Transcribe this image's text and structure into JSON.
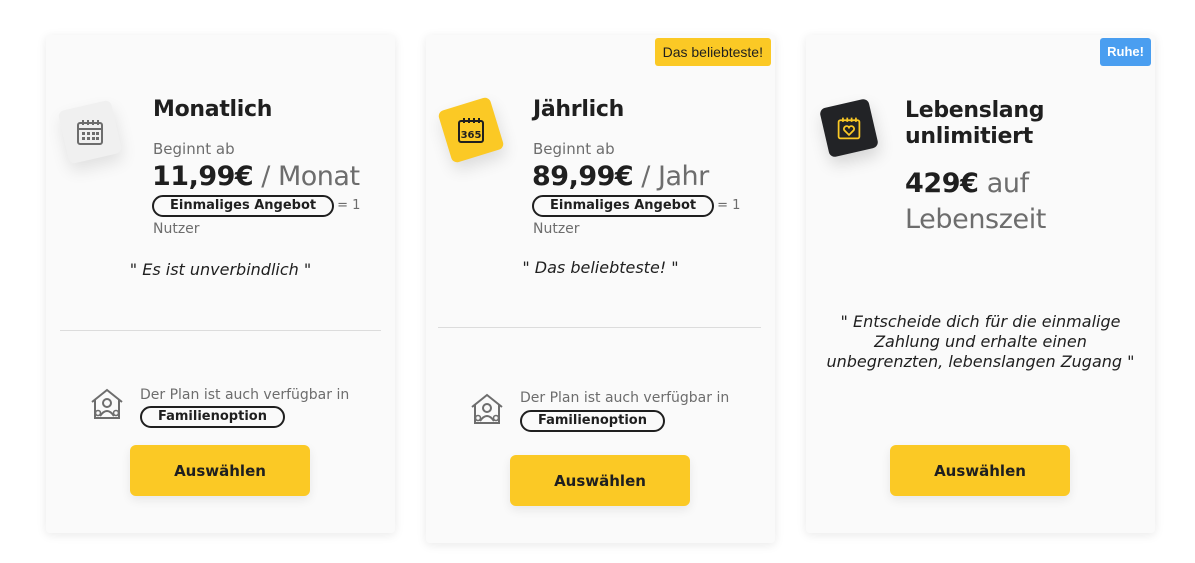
{
  "plans": [
    {
      "title": "Monatlich",
      "starts_label": "Beginnt ab",
      "price": "11,99€",
      "period": "/ Monat",
      "offer_pill": "Einmaliges Angebot",
      "offer_eq": "= 1",
      "offer_users": "Nutzer",
      "quote": "\" Es ist unverbindlich \"",
      "family_text": "Der Plan ist auch verfügbar in",
      "family_pill": "Familienoption",
      "button": "Auswählen",
      "icon": "calendar-icon"
    },
    {
      "badge": "Das beliebteste!",
      "title": "Jährlich",
      "starts_label": "Beginnt ab",
      "price": "89,99€",
      "period": "/ Jahr",
      "offer_pill": "Einmaliges Angebot",
      "offer_eq": "= 1",
      "offer_users": "Nutzer",
      "quote": "\" Das beliebteste! \"",
      "family_text": "Der Plan ist auch verfügbar in",
      "family_pill": "Familienoption",
      "button": "Auswählen",
      "icon": "calendar-365-icon",
      "icon_text": "365"
    },
    {
      "badge": "Ruhe!",
      "title_line1": "Lebenslang",
      "title_line2": "unlimitiert",
      "price": "429€",
      "period_line1": "auf",
      "period_line2": "Lebenszeit",
      "quote_line1": "\" Entscheide dich für die einmalige",
      "quote_line2": "Zahlung und erhalte einen",
      "quote_line3": "unbegrenzten, lebenslangen Zugang \"",
      "button": "Auswählen",
      "icon": "calendar-heart-icon"
    }
  ],
  "colors": {
    "accent": "#fbc925",
    "badge_blue": "#4a9ef0",
    "dark_icon": "#222326",
    "text": "#1f1f1f",
    "muted": "#6d6d6d"
  }
}
